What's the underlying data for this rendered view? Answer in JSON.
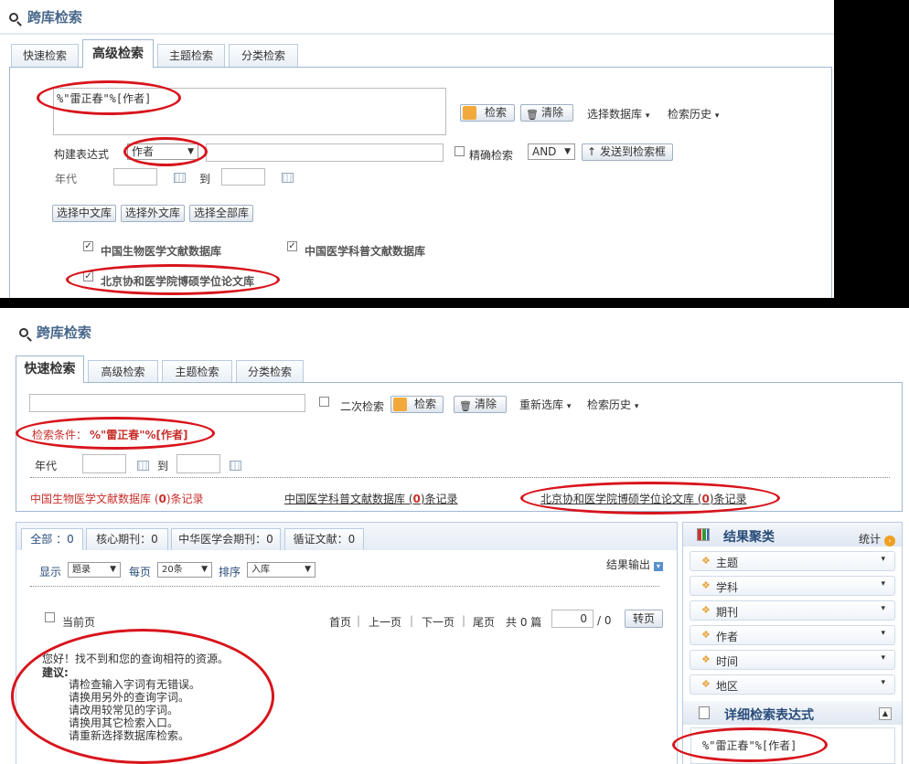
{
  "top": {
    "title": "跨库检索",
    "tabs": [
      "快速检索",
      "高级检索",
      "主题检索",
      "分类检索"
    ],
    "query_text": "%\"雷正春\"%[作者]",
    "search_btn": "检索",
    "clear_btn": "清除",
    "select_db": "选择数据库",
    "history": "检索历史",
    "build_label": "构建表达式",
    "field_select": "作者",
    "exact_label": "精确检索",
    "logic_select": "AND",
    "send_btn": "发送到检索框",
    "year_label": "年代",
    "to_label": "到",
    "btn_cn": "选择中文库",
    "btn_foreign": "选择外文库",
    "btn_all": "选择全部库",
    "databases": [
      "中国生物医学文献数据库",
      "中国医学科普文献数据库",
      "北京协和医学院博硕学位论文库"
    ]
  },
  "bottom": {
    "title": "跨库检索",
    "tabs": [
      "快速检索",
      "高级检索",
      "主题检索",
      "分类检索"
    ],
    "secondary_label": "二次检索",
    "search_btn": "检索",
    "clear_btn": "清除",
    "reselect": "重新选库",
    "history": "检索历史",
    "cond_label": "检索条件：",
    "cond_value": "%\"雷正春\"%[作者]",
    "year_label": "年代",
    "to_label": "到",
    "db_counts": [
      {
        "name": "中国生物医学文献数据库 (",
        "count": "0",
        "suffix": ")条记录"
      },
      {
        "name": "中国医学科普文献数据库 (",
        "count": "0",
        "suffix": ")条记录"
      },
      {
        "name": "北京协和医学院博硕学位论文库 (",
        "count": "0",
        "suffix": ")条记录"
      }
    ],
    "result_tabs": [
      "全部 ：0",
      "核心期刊：0",
      "中华医学会期刊：0",
      "循证文献：0"
    ],
    "export": "结果输出",
    "display_label": "显示",
    "display_value": "题录",
    "perpage_label": "每页",
    "perpage_value": "20条",
    "sort_label": "排序",
    "sort_value": "入库",
    "current_page": "当前页",
    "pager": {
      "first": "首页",
      "prev": "上一页",
      "next": "下一页",
      "last": "尾页",
      "total": "共 0 篇",
      "page": "0",
      "of": "/ 0",
      "go": "转页"
    },
    "no_result": "您好！找不到和您的查询相符的资源。",
    "suggest_title": "建议:",
    "suggestions": [
      "请检查输入字词有无错误。",
      "请换用另外的查询字词。",
      "请改用较常见的字词。",
      "请换用其它检索入口。",
      "请重新选择数据库检索。"
    ],
    "cluster_title": "结果聚类",
    "stats": "统计",
    "facets": [
      "主题",
      "学科",
      "期刊",
      "作者",
      "时间",
      "地区"
    ],
    "detail_title": "详细检索表达式",
    "detail_value": "%\"雷正春\"%[作者]"
  },
  "colors": {
    "accent": "#47678a",
    "highlight_red": "#c8302c",
    "annotation": "#d8141c"
  }
}
